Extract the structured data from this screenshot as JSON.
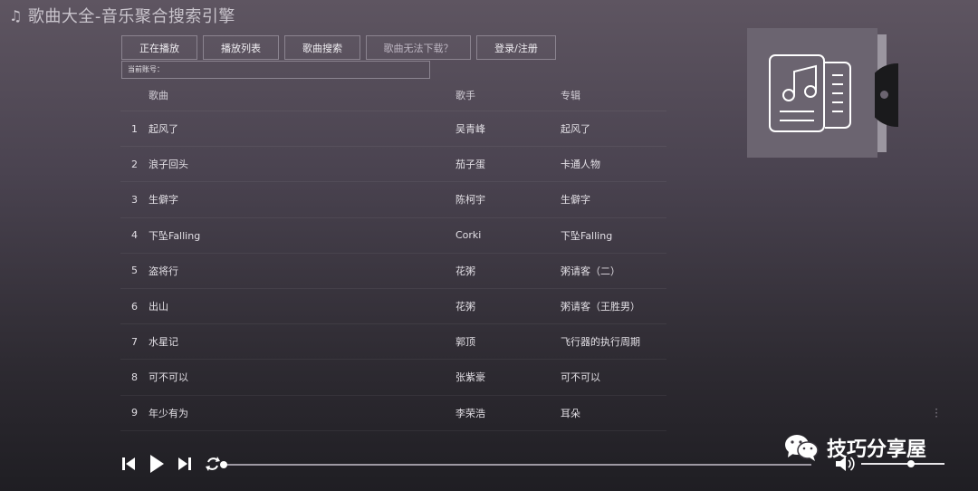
{
  "app": {
    "title": "歌曲大全-音乐聚合搜索引擎",
    "title_icon": "music-note-icon"
  },
  "nav": [
    {
      "label": "正在播放"
    },
    {
      "label": "播放列表"
    },
    {
      "label": "歌曲搜索"
    },
    {
      "label": "歌曲无法下载？"
    },
    {
      "label": "登录/注册"
    }
  ],
  "account": {
    "label": "当前账号："
  },
  "table": {
    "headers": {
      "song": "歌曲",
      "artist": "歌手",
      "album": "专辑"
    },
    "rows": [
      {
        "num": "1",
        "song": "起风了",
        "artist": "吴青峰",
        "album": "起风了"
      },
      {
        "num": "2",
        "song": "浪子回头",
        "artist": "茄子蛋",
        "album": "卡通人物"
      },
      {
        "num": "3",
        "song": "生僻字",
        "artist": "陈柯宇",
        "album": "生僻字"
      },
      {
        "num": "4",
        "song": "下坠Falling",
        "artist": "Corki",
        "album": "下坠Falling"
      },
      {
        "num": "5",
        "song": "盗将行",
        "artist": "花粥",
        "album": "粥请客（二）"
      },
      {
        "num": "6",
        "song": "出山",
        "artist": "花粥",
        "album": "粥请客（王胜男）"
      },
      {
        "num": "7",
        "song": "水星记",
        "artist": "郭顶",
        "album": "飞行器的执行周期"
      },
      {
        "num": "8",
        "song": "可不可以",
        "artist": "张紫豪",
        "album": "可不可以"
      },
      {
        "num": "9",
        "song": "年少有为",
        "artist": "李荣浩",
        "album": "耳朵"
      }
    ]
  },
  "player": {
    "progress": 0.0,
    "volume": 0.6
  },
  "watermark": {
    "text": "技巧分享屋",
    "icon": "wechat-icon"
  },
  "colors": {
    "bg_top": "#5e5561",
    "bg_bottom": "#1f1e23",
    "border": "#8b8490"
  }
}
